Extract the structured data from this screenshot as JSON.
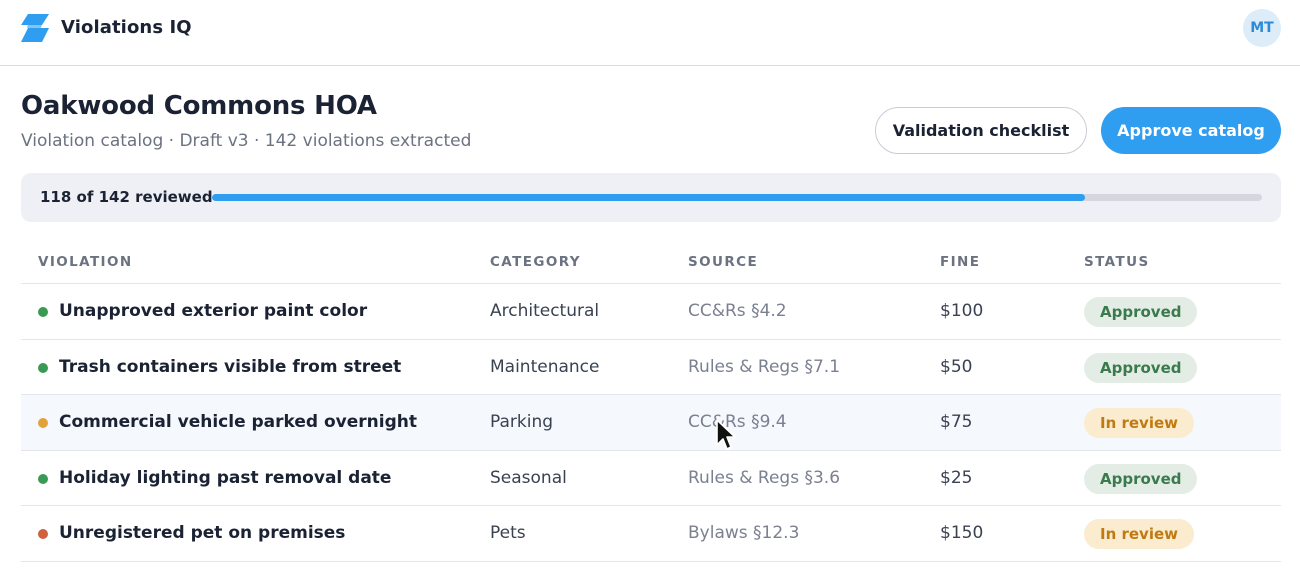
{
  "app": {
    "name": "Violations IQ",
    "user_initials": "MT"
  },
  "header": {
    "title": "Oakwood Commons HOA",
    "subtitle": "Violation catalog · Draft v3 · 142 violations extracted",
    "buttons": {
      "checklist": "Validation checklist",
      "approve": "Approve catalog"
    }
  },
  "progress": {
    "label": "118 of 142 reviewed",
    "reviewed": 118,
    "total": 142
  },
  "colors": {
    "accent": "#2f9df0",
    "dot_green": "#3a9a54",
    "dot_amber": "#e2a23a",
    "dot_red": "#d0603e"
  },
  "table": {
    "columns": {
      "violation": "VIOLATION",
      "category": "CATEGORY",
      "source": "SOURCE",
      "fine": "FINE",
      "status": "STATUS"
    },
    "rows": [
      {
        "violation": "Unapproved exterior paint color",
        "category": "Architectural",
        "source": "CC&Rs §4.2",
        "fine": "$100",
        "status": "Approved"
      },
      {
        "violation": "Trash containers visible from street",
        "category": "Maintenance",
        "source": "Rules & Regs §7.1",
        "fine": "$50",
        "status": "Approved"
      },
      {
        "violation": "Commercial vehicle parked overnight",
        "category": "Parking",
        "source": "CC&Rs §9.4",
        "fine": "$75",
        "status": "In review"
      },
      {
        "violation": "Holiday lighting past removal date",
        "category": "Seasonal",
        "source": "Rules & Regs §3.6",
        "fine": "$25",
        "status": "Approved"
      },
      {
        "violation": "Unregistered pet on premises",
        "category": "Pets",
        "source": "Bylaws §12.3",
        "fine": "$150",
        "status": "In review"
      }
    ]
  }
}
